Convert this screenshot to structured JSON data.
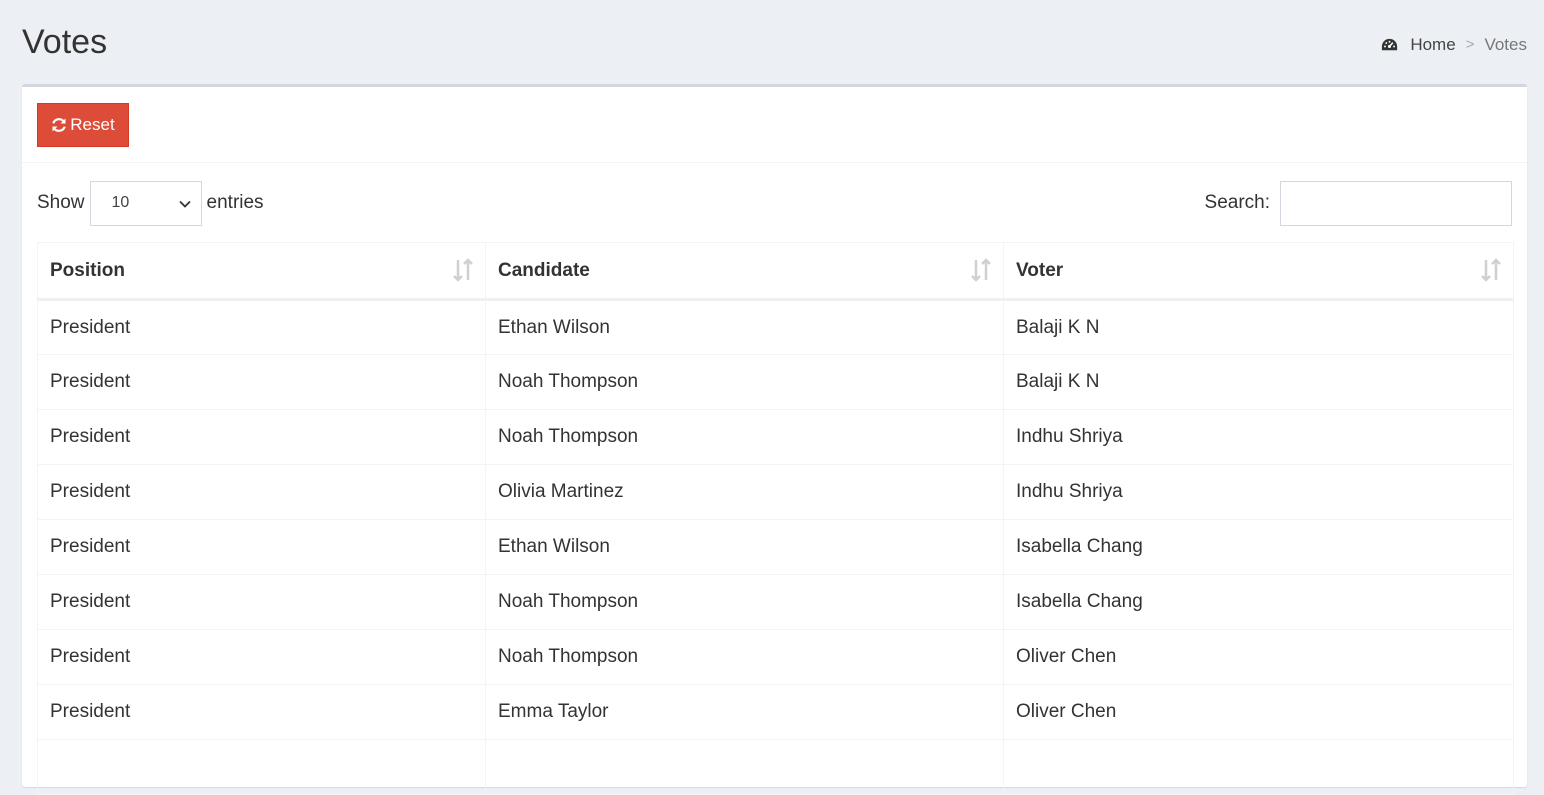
{
  "header": {
    "title": "Votes",
    "breadcrumb": {
      "home_icon": "dashboard-icon",
      "home_label": "Home",
      "separator": ">",
      "current": "Votes"
    }
  },
  "toolbar": {
    "reset_label": "Reset",
    "reset_icon": "refresh-icon",
    "reset_color": "#dd4b39"
  },
  "controls": {
    "show_label": "Show",
    "page_length_value": "10",
    "entries_label": "entries",
    "search_label": "Search:",
    "search_value": ""
  },
  "table": {
    "columns": [
      "Position",
      "Candidate",
      "Voter"
    ],
    "rows": [
      [
        "President",
        "Ethan Wilson",
        "Balaji K N"
      ],
      [
        "President",
        "Noah Thompson",
        "Balaji K N"
      ],
      [
        "President",
        "Noah Thompson",
        "Indhu Shriya"
      ],
      [
        "President",
        "Olivia Martinez",
        "Indhu Shriya"
      ],
      [
        "President",
        "Ethan Wilson",
        "Isabella Chang"
      ],
      [
        "President",
        "Noah Thompson",
        "Isabella Chang"
      ],
      [
        "President",
        "Noah Thompson",
        "Oliver Chen"
      ],
      [
        "President",
        "Emma Taylor",
        "Oliver Chen"
      ],
      [
        "",
        "",
        ""
      ]
    ]
  }
}
